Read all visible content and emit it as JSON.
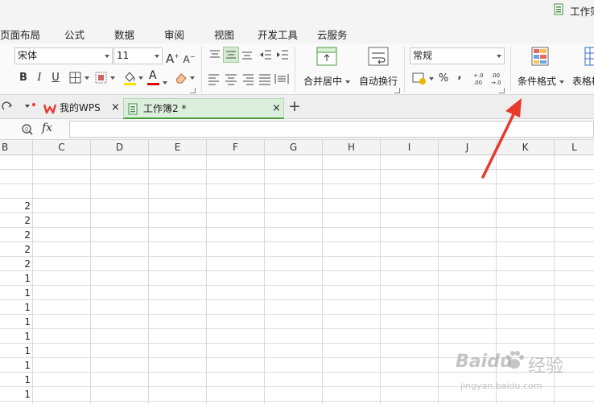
{
  "title_bar": {
    "title": "工作簿"
  },
  "menu": {
    "items": [
      "页面布局",
      "公式",
      "数据",
      "审阅",
      "视图",
      "开发工具",
      "云服务"
    ]
  },
  "ribbon": {
    "font_name": "宋体",
    "font_size": "11",
    "grow_font": "A",
    "shrink_font": "A",
    "bold": "B",
    "italic": "I",
    "underline": "U",
    "font_color_glyph": "A",
    "merge_center_label": "合并居中",
    "wrap_text_label": "自动换行",
    "number_format": "常规",
    "percent": "%",
    "comma": ",",
    "conditional_format_label": "条件格式",
    "table_style_label": "表格样",
    "accent_color": "#4a9a3a",
    "fill_color": "#ffe000",
    "font_color": "#e00000"
  },
  "tabs": [
    {
      "label": "我的WPS",
      "close": "×",
      "active": false
    },
    {
      "label": "工作簿2 *",
      "close": "×",
      "active": true
    }
  ],
  "new_tab": "+",
  "formula_bar": {
    "fx": "fx",
    "value": ""
  },
  "columns": [
    "B",
    "C",
    "D",
    "E",
    "F",
    "G",
    "H",
    "I",
    "J",
    "K",
    "L"
  ],
  "column_b_values": [
    "",
    "",
    "",
    "2",
    "2",
    "2",
    "2",
    "2",
    "1",
    "1",
    "1",
    "1",
    "1",
    "1",
    "1",
    "1",
    "1"
  ],
  "annotation": {
    "color": "#e8392d"
  },
  "watermark": {
    "logo": "Baidu",
    "text": "经验",
    "url": "jingyan.baidu.com"
  }
}
